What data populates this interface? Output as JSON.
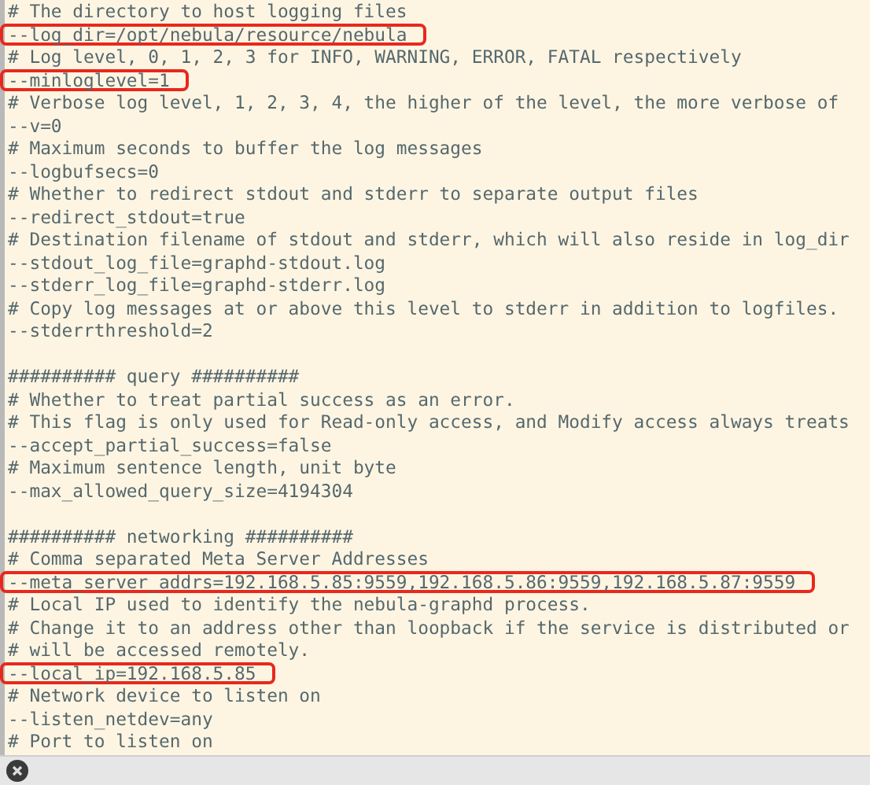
{
  "lines": [
    {
      "kind": "text",
      "text": "# The directory to host logging files",
      "highlighted": false
    },
    {
      "kind": "text",
      "text": "--log_dir=/opt/nebula/resource/nebula",
      "highlighted": true
    },
    {
      "kind": "text",
      "text": "# Log level, 0, 1, 2, 3 for INFO, WARNING, ERROR, FATAL respectively",
      "highlighted": false
    },
    {
      "kind": "text",
      "text": "--minloglevel=1",
      "highlighted": true
    },
    {
      "kind": "text",
      "text": "# Verbose log level, 1, 2, 3, 4, the higher of the level, the more verbose of",
      "highlighted": false
    },
    {
      "kind": "text",
      "text": "--v=0",
      "highlighted": false
    },
    {
      "kind": "text",
      "text": "# Maximum seconds to buffer the log messages",
      "highlighted": false
    },
    {
      "kind": "text",
      "text": "--logbufsecs=0",
      "highlighted": false
    },
    {
      "kind": "text",
      "text": "# Whether to redirect stdout and stderr to separate output files",
      "highlighted": false
    },
    {
      "kind": "text",
      "text": "--redirect_stdout=true",
      "highlighted": false
    },
    {
      "kind": "text",
      "text": "# Destination filename of stdout and stderr, which will also reside in log_dir",
      "highlighted": false
    },
    {
      "kind": "text",
      "text": "--stdout_log_file=graphd-stdout.log",
      "highlighted": false
    },
    {
      "kind": "text",
      "text": "--stderr_log_file=graphd-stderr.log",
      "highlighted": false
    },
    {
      "kind": "text",
      "text": "# Copy log messages at or above this level to stderr in addition to logfiles.",
      "highlighted": false
    },
    {
      "kind": "text",
      "text": "--stderrthreshold=2",
      "highlighted": false
    },
    {
      "kind": "blank"
    },
    {
      "kind": "text",
      "text": "########## query ##########",
      "highlighted": false
    },
    {
      "kind": "text",
      "text": "# Whether to treat partial success as an error.",
      "highlighted": false
    },
    {
      "kind": "text",
      "text": "# This flag is only used for Read-only access, and Modify access always treats",
      "highlighted": false
    },
    {
      "kind": "text",
      "text": "--accept_partial_success=false",
      "highlighted": false
    },
    {
      "kind": "text",
      "text": "# Maximum sentence length, unit byte",
      "highlighted": false
    },
    {
      "kind": "text",
      "text": "--max_allowed_query_size=4194304",
      "highlighted": false
    },
    {
      "kind": "blank"
    },
    {
      "kind": "text",
      "text": "########## networking ##########",
      "highlighted": false
    },
    {
      "kind": "text",
      "text": "# Comma separated Meta Server Addresses",
      "highlighted": false
    },
    {
      "kind": "text",
      "text": "--meta_server_addrs=192.168.5.85:9559,192.168.5.86:9559,192.168.5.87:9559",
      "highlighted": true
    },
    {
      "kind": "text",
      "text": "# Local IP used to identify the nebula-graphd process.",
      "highlighted": false
    },
    {
      "kind": "text",
      "text": "# Change it to an address other than loopback if the service is distributed or",
      "highlighted": false
    },
    {
      "kind": "text",
      "text": "# will be accessed remotely.",
      "highlighted": false
    },
    {
      "kind": "text",
      "text": "--local_ip=192.168.5.85",
      "highlighted": true
    },
    {
      "kind": "text",
      "text": "# Network device to listen on",
      "highlighted": false
    },
    {
      "kind": "text",
      "text": "--listen_netdev=any",
      "highlighted": false
    },
    {
      "kind": "text",
      "text": "# Port to listen on",
      "highlighted": false
    }
  ]
}
